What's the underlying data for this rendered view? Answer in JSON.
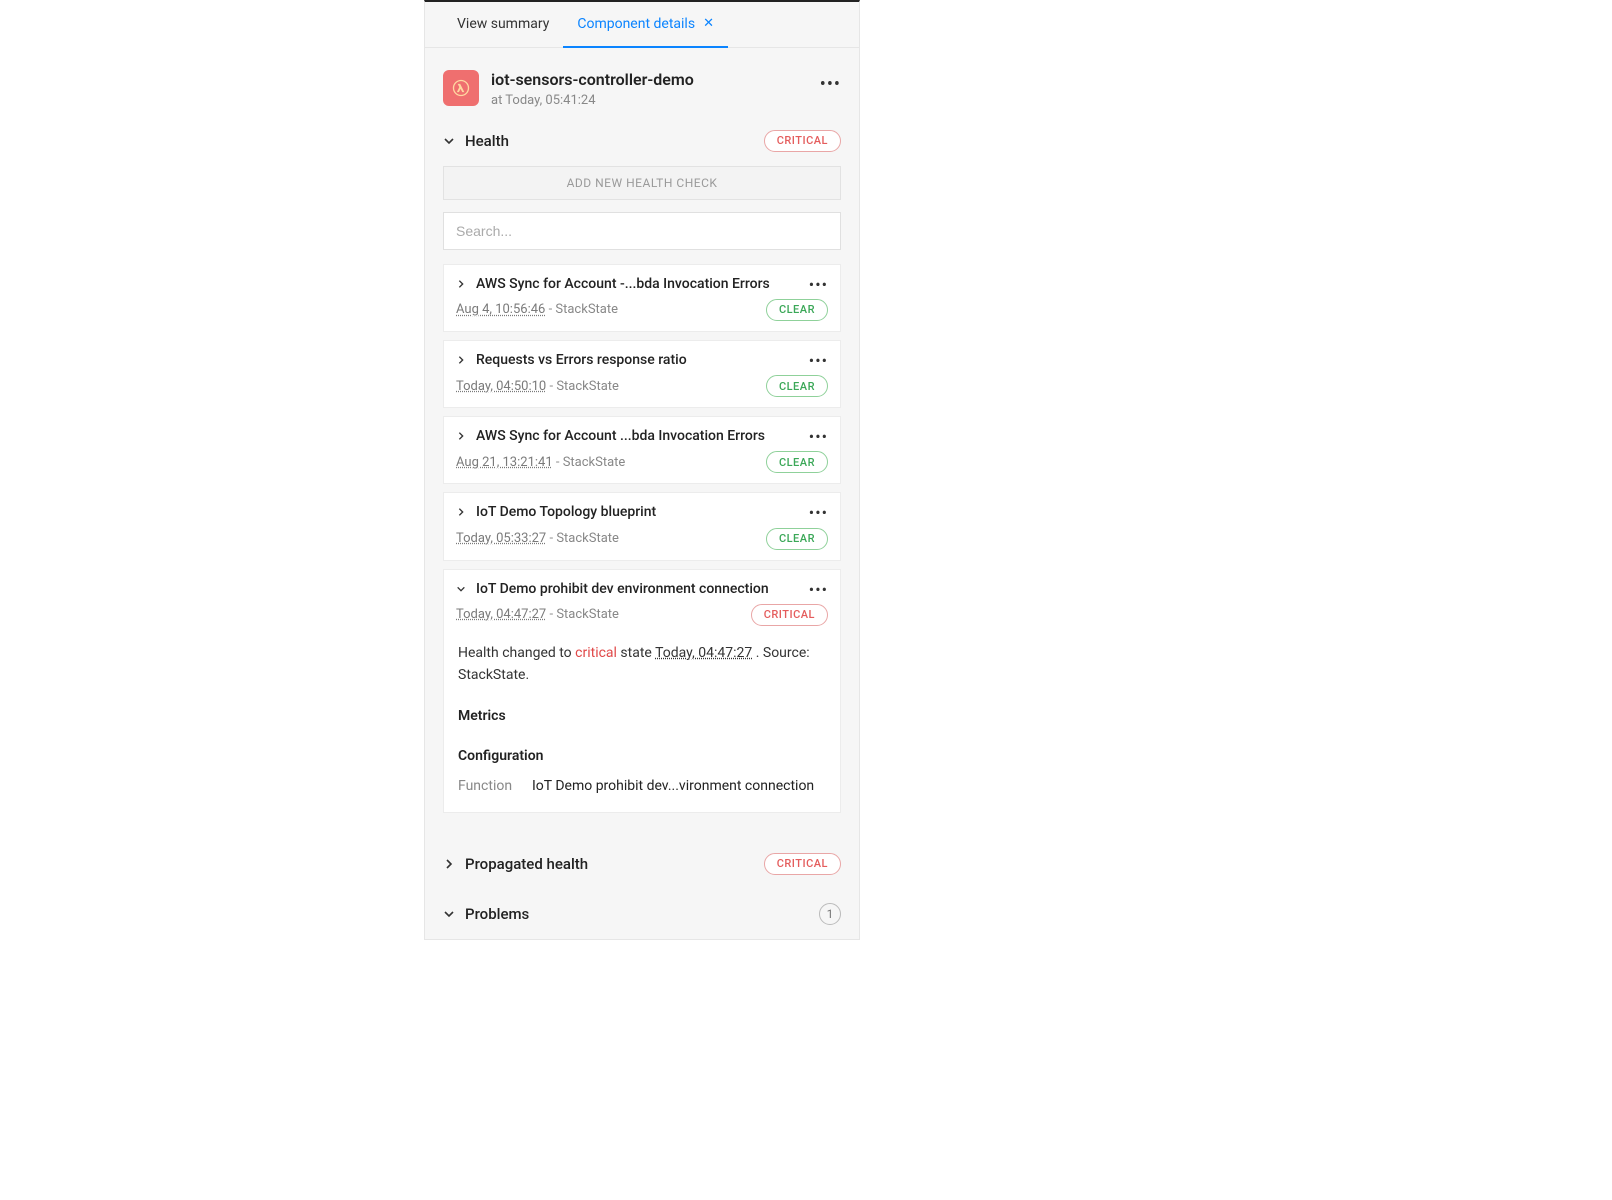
{
  "tabs": {
    "view_summary": "View summary",
    "component_details": "Component details"
  },
  "header": {
    "title": "iot-sensors-controller-demo",
    "subtitle": "at Today, 05:41:24"
  },
  "sections": {
    "health": {
      "title": "Health",
      "badge": "CRITICAL",
      "add_button": "ADD NEW HEALTH CHECK",
      "search_placeholder": "Search..."
    },
    "propagated": {
      "title": "Propagated health",
      "badge": "CRITICAL"
    },
    "problems": {
      "title": "Problems",
      "count": "1"
    }
  },
  "checks": [
    {
      "title": "AWS Sync for Account -...bda Invocation Errors",
      "timestamp": "Aug 4, 10:56:46",
      "source": "StackState",
      "status": "CLEAR",
      "expanded": false
    },
    {
      "title": "Requests vs Errors response ratio",
      "timestamp": "Today, 04:50:10",
      "source": "StackState",
      "status": "CLEAR",
      "expanded": false
    },
    {
      "title": "AWS Sync for Account ...bda Invocation Errors",
      "timestamp": "Aug 21, 13:21:41",
      "source": "StackState",
      "status": "CLEAR",
      "expanded": false
    },
    {
      "title": "IoT Demo Topology blueprint",
      "timestamp": "Today, 05:33:27",
      "source": "StackState",
      "status": "CLEAR",
      "expanded": false
    },
    {
      "title": "IoT Demo prohibit dev environment connection",
      "timestamp": "Today, 04:47:27",
      "source": "StackState",
      "status": "CRITICAL",
      "expanded": true
    }
  ],
  "expanded_detail": {
    "prefix": "Health changed to ",
    "state": "critical",
    "mid": " state ",
    "timestamp": "Today, 04:47:27",
    "suffix1": " . Source: ",
    "source": "StackState",
    "suffix2": ".",
    "metrics_heading": "Metrics",
    "config_heading": "Configuration",
    "function_label": "Function",
    "function_value": "IoT Demo prohibit dev...vironment connection"
  }
}
